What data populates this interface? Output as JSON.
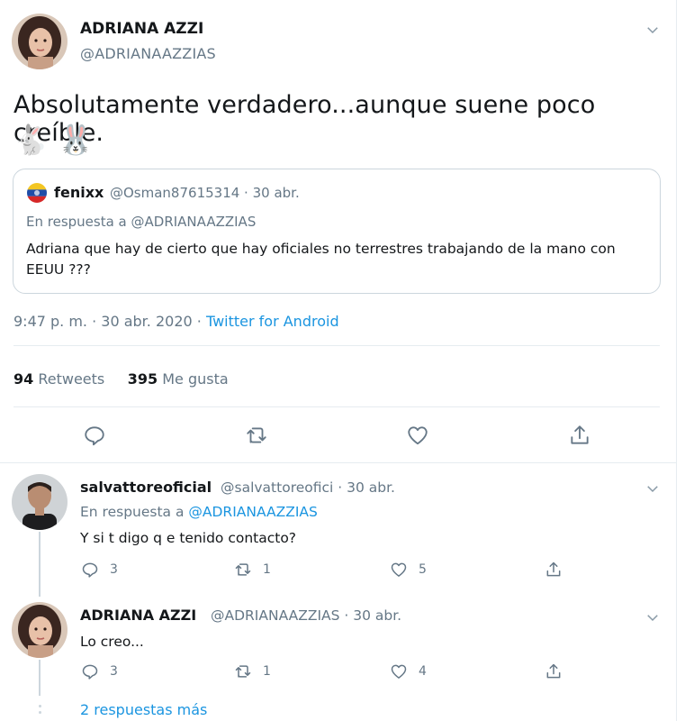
{
  "tweet": {
    "author_name": "ADRIANA AZZI",
    "author_handle": "@ADRIANAAZZIAS",
    "text": "Absolutamente verdadero...aunque suene poco creíble.",
    "emoji": "🐇 🐰",
    "timestamp": "9:47 p. m. · 30 abr. 2020 · ",
    "source": "Twitter for Android",
    "retweets_count": "94",
    "retweets_label": "Retweets",
    "likes_count": "395",
    "likes_label": "Me gusta"
  },
  "quoted": {
    "name": "fenixx",
    "meta": "@Osman87615314 · 30 abr.",
    "reply_to": "En respuesta a @ADRIANAAZZIAS",
    "text": "Adriana que hay de cierto que hay oficiales no terrestres trabajando de la mano con EEUU ???"
  },
  "replies": [
    {
      "name": "salvattoreoficial",
      "meta": "@salvattoreofici · 30 abr.",
      "reply_prefix": "En respuesta a ",
      "reply_handle": "@ADRIANAAZZIAS",
      "text": "Y si t digo q e tenido contacto?",
      "reply_count": "3",
      "retweet_count": "1",
      "like_count": "5"
    },
    {
      "name": "ADRIANA AZZI",
      "meta": "@ADRIANAAZZIAS · 30 abr.",
      "text": "Lo creo...",
      "reply_count": "3",
      "retweet_count": "1",
      "like_count": "4"
    }
  ],
  "more_replies": "2 respuestas más",
  "icons": {
    "reply": "reply-icon",
    "retweet": "retweet-icon",
    "like": "heart-icon",
    "share": "share-icon",
    "menu": "chevron-down-icon"
  },
  "colors": {
    "link": "#1b95e0",
    "secondary_text": "#657786",
    "border": "#e6ecf0"
  }
}
